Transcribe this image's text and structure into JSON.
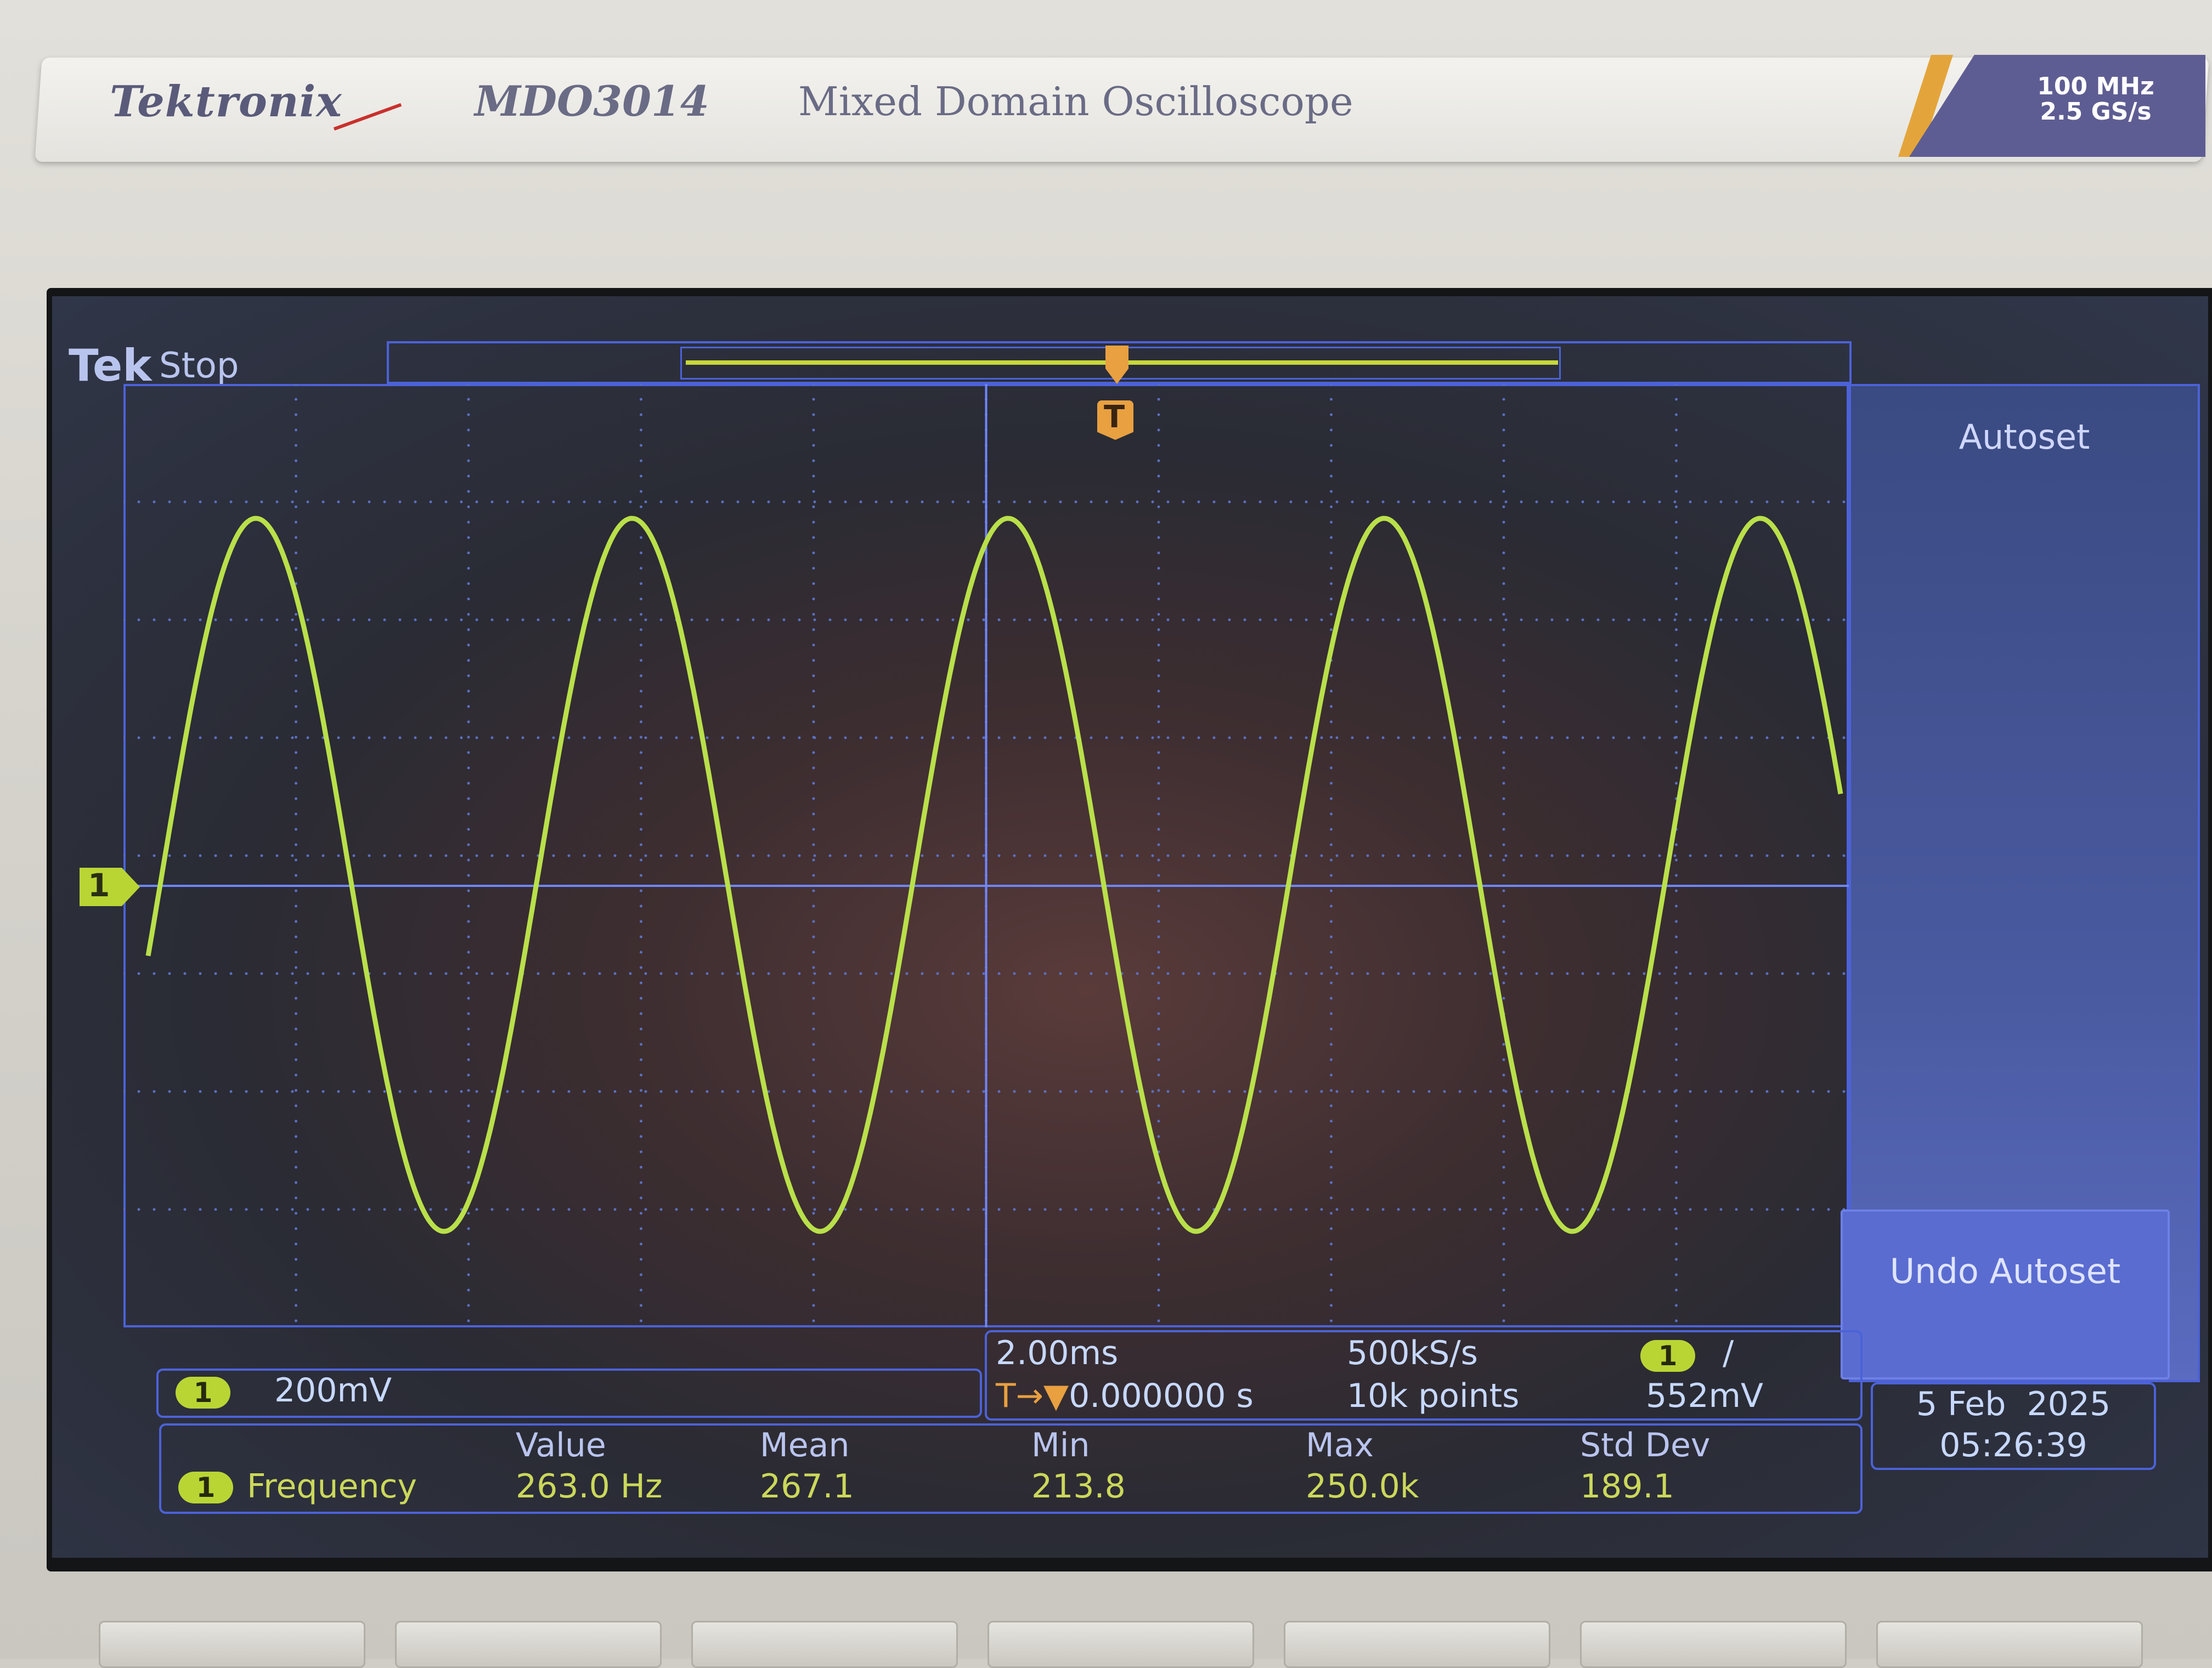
{
  "device": {
    "brand": "Tektronix",
    "model": "MDO3014",
    "description": "Mixed Domain Oscilloscope",
    "bandwidth": "100 MHz",
    "sample_rate_max": "2.5 GS/s"
  },
  "status": {
    "logo": "Tek",
    "state": "Stop"
  },
  "side_menu": {
    "title": "Autoset",
    "undo_button": "Undo Autoset"
  },
  "channel": {
    "number": "1",
    "scale": "200mV"
  },
  "timebase": {
    "scale": "2.00ms",
    "trigger_position": "0.000000 s",
    "trigger_position_prefix": "T→▼",
    "sample_rate": "500kS/s",
    "record_length": "10k points",
    "trigger_channel": "1",
    "trigger_slope": "∕",
    "trigger_level": "552mV"
  },
  "measurement": {
    "channel": "1",
    "name": "Frequency",
    "headers": {
      "value": "Value",
      "mean": "Mean",
      "min": "Min",
      "max": "Max",
      "std_dev": "Std Dev"
    },
    "values": {
      "value": "263.0 Hz",
      "mean": "267.1",
      "min": "213.8",
      "max": "250.0k",
      "std_dev": "189.1"
    }
  },
  "datetime": {
    "date": "5 Feb  2025",
    "time": "05:26:39"
  },
  "waveform": {
    "shape": "sine",
    "frequency_hz": 263.0,
    "cycles_shown": 4.5,
    "color": "#b9e04a"
  },
  "colors": {
    "waveform": "#b9e04a",
    "channel1": "#b9d534",
    "trigger": "#e8a040",
    "ui_blue": "#4c62d8",
    "readout_text": "#c7d8ff"
  }
}
